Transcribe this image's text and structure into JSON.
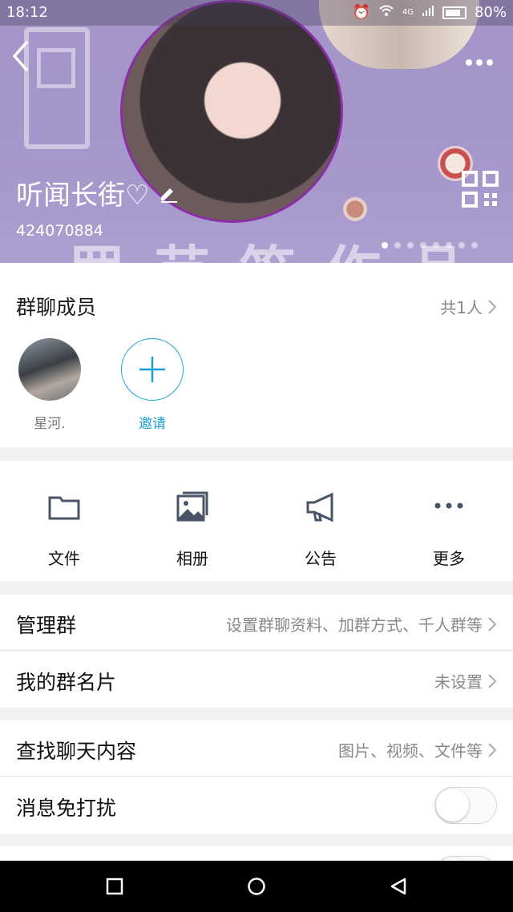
{
  "status_bar": {
    "time": "18:12",
    "network": "4G",
    "battery": "80%"
  },
  "header": {
    "group_name": "听闻长街♡",
    "group_id": "424070884",
    "background_text": "罗 芸 笛 作 品",
    "page_indicator": {
      "total": 8,
      "active": 0
    }
  },
  "members": {
    "title": "群聊成员",
    "count_text": "共1人",
    "list": [
      {
        "name": "星河."
      }
    ],
    "invite_label": "邀请"
  },
  "functions": [
    {
      "label": "文件",
      "icon": "folder-icon"
    },
    {
      "label": "相册",
      "icon": "photo-album-icon"
    },
    {
      "label": "公告",
      "icon": "megaphone-icon"
    },
    {
      "label": "更多",
      "icon": "more-dots-icon"
    }
  ],
  "settings": {
    "manage": {
      "title": "管理群",
      "value": "设置群聊资料、加群方式、千人群等"
    },
    "card": {
      "title": "我的群名片",
      "value": "未设置"
    },
    "search": {
      "title": "查找聊天内容",
      "value": "图片、视频、文件等"
    },
    "dnd": {
      "title": "消息免打扰",
      "enabled": false
    }
  },
  "colors": {
    "accent": "#1aa0d8",
    "header_bg": "#a595c9"
  }
}
